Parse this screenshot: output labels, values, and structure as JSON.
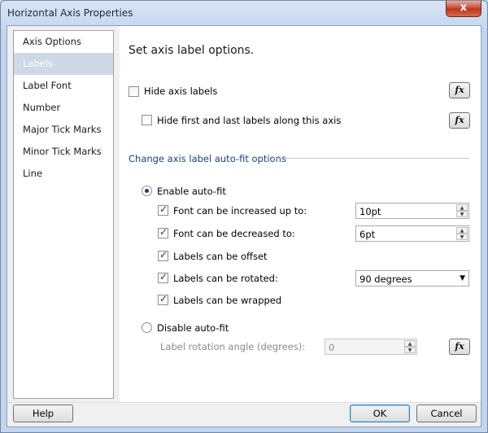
{
  "window": {
    "title": "Horizontal Axis Properties",
    "close_glyph": "x"
  },
  "nav": {
    "items": [
      {
        "label": "Axis Options"
      },
      {
        "label": "Labels"
      },
      {
        "label": "Label Font"
      },
      {
        "label": "Number"
      },
      {
        "label": "Major Tick Marks"
      },
      {
        "label": "Minor Tick Marks"
      },
      {
        "label": "Line"
      }
    ],
    "selected": "Labels"
  },
  "panel": {
    "heading": "Set axis label options.",
    "hide_axis_labels": {
      "label": "Hide axis labels",
      "checked": false
    },
    "hide_first_last": {
      "label": "Hide first and last labels along this axis",
      "checked": false
    },
    "fx_label": "fx",
    "section_title": "Change axis label auto-fit options",
    "enable_autofit": {
      "label": "Enable auto-fit",
      "selected": true
    },
    "font_increase": {
      "label": "Font can be increased up to:",
      "checked": true,
      "value": "10pt"
    },
    "font_decrease": {
      "label": "Font can be decreased to:",
      "checked": true,
      "value": "6pt"
    },
    "labels_offset": {
      "label": "Labels can be offset",
      "checked": true
    },
    "labels_rotated": {
      "label": "Labels can be rotated:",
      "checked": true,
      "value": "90 degrees"
    },
    "labels_wrapped": {
      "label": "Labels can be wrapped",
      "checked": true
    },
    "disable_autofit": {
      "label": "Disable auto-fit",
      "selected": false
    },
    "rotation_angle": {
      "label": "Label rotation angle (degrees):",
      "value": "0"
    }
  },
  "footer": {
    "help": "Help",
    "ok": "OK",
    "cancel": "Cancel"
  },
  "icons": {
    "spin_up": "▲",
    "spin_down": "▼",
    "dropdown": "▼"
  },
  "colors": {
    "selection": "#cfd8e5",
    "section_title": "#1f3f7a"
  }
}
